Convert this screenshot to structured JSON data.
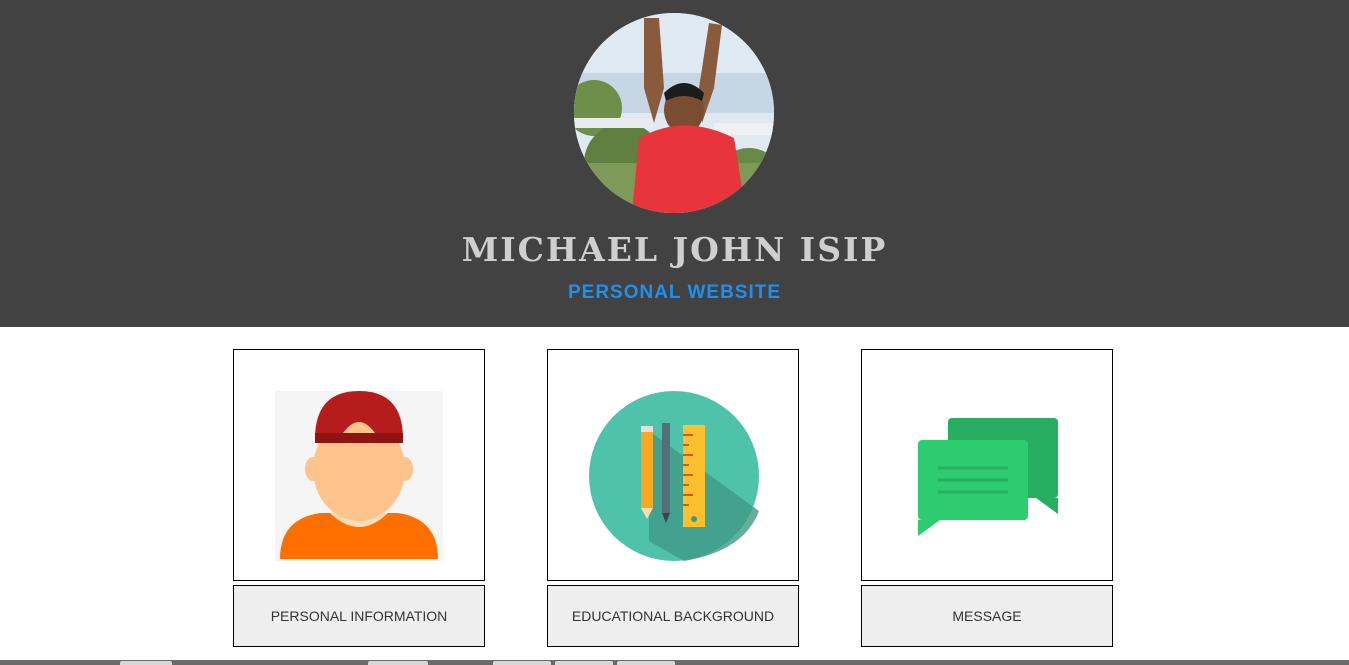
{
  "header": {
    "name": "MICHAEL JOHN ISIP",
    "subtitle": "PERSONAL WEBSITE"
  },
  "cards": [
    {
      "label": "PERSONAL INFORMATION",
      "icon": "person-with-cap-icon"
    },
    {
      "label": "EDUCATIONAL BACKGROUND",
      "icon": "school-supplies-icon"
    },
    {
      "label": "MESSAGE",
      "icon": "chat-bubbles-icon"
    }
  ],
  "colors": {
    "header_bg": "#424242",
    "name": "#cfcfcf",
    "subtitle": "#1e90f0",
    "button_bg": "#eeeeee"
  }
}
